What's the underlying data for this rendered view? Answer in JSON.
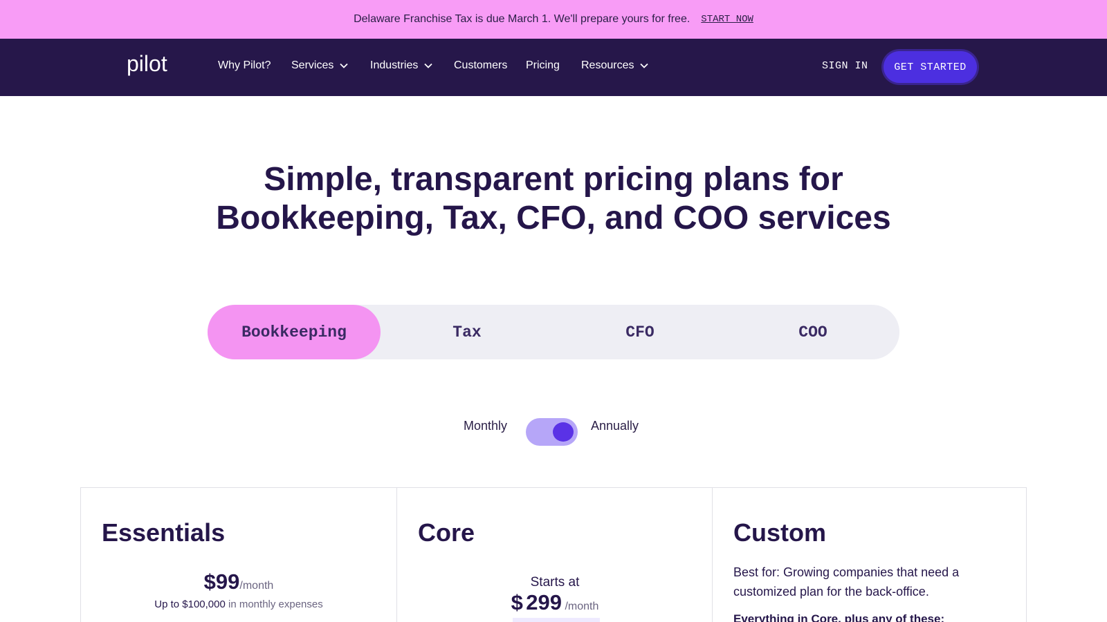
{
  "banner": {
    "text": "Delaware Franchise Tax is due March 1. We'll prepare yours for free.",
    "link": "START NOW"
  },
  "nav": {
    "logo": "pilot",
    "items": [
      {
        "label": "Why Pilot?",
        "has_dropdown": false
      },
      {
        "label": "Services",
        "has_dropdown": true
      },
      {
        "label": "Industries",
        "has_dropdown": true
      },
      {
        "label": "Customers",
        "has_dropdown": false
      },
      {
        "label": "Pricing",
        "has_dropdown": false
      },
      {
        "label": "Resources",
        "has_dropdown": true
      }
    ],
    "sign_in": "SIGN IN",
    "cta": "GET STARTED"
  },
  "hero": {
    "line1": "Simple, transparent pricing plans for",
    "line2": "Bookkeeping, Tax, CFO, and COO services"
  },
  "tabs": [
    {
      "label": "Bookkeeping",
      "active": true
    },
    {
      "label": "Tax",
      "active": false
    },
    {
      "label": "CFO",
      "active": false
    },
    {
      "label": "COO",
      "active": false
    }
  ],
  "billing": {
    "monthly": "Monthly",
    "annually": "Annually",
    "selected": "Annually"
  },
  "plans": [
    {
      "name": "Essentials",
      "price": "$99",
      "unit": "/month",
      "limit_value": "Up to $100,000",
      "limit_suffix": "in monthly expenses"
    },
    {
      "name": "Core",
      "prefix": "Starts at",
      "currency": "$",
      "price": "299",
      "unit": "/month"
    },
    {
      "name": "Custom",
      "description": "Best for: Growing companies that need a customized plan for the back-office.",
      "subheading": "Everything in Core, plus any of these:"
    }
  ],
  "colors": {
    "banner_bg": "#f89cf6",
    "nav_bg": "#26174a",
    "cta_bg": "#4c2fe0",
    "tab_active_bg": "#f494f2",
    "tabs_track": "#eeeef4",
    "toggle_track": "#b6a6f8",
    "toggle_knob": "#5a32e6",
    "heading": "#25164a"
  }
}
